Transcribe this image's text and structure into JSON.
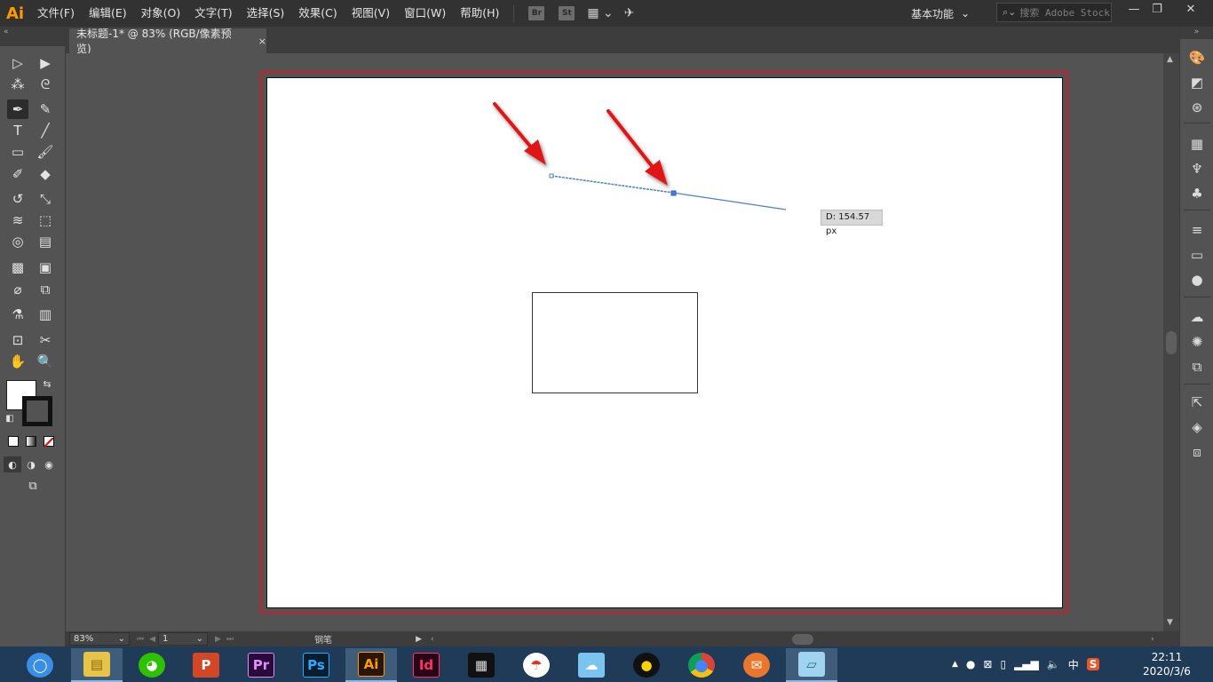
{
  "app": {
    "logo": "Ai",
    "menus": [
      "文件(F)",
      "编辑(E)",
      "对象(O)",
      "文字(T)",
      "选择(S)",
      "效果(C)",
      "视图(V)",
      "窗口(W)",
      "帮助(H)"
    ],
    "bridge_button": "Br",
    "stock_button": "St",
    "workspace": "基本功能",
    "search_placeholder": "搜索 Adobe Stock",
    "window_controls": {
      "minimize": "—",
      "restore": "❐",
      "close": "✕"
    }
  },
  "document": {
    "tab_title": "未标题-1* @ 83% (RGB/像素预览)",
    "tab_close": "×",
    "measure_tooltip": "D: 154.57 px"
  },
  "tools": {
    "names": [
      "selection-tool",
      "direct-selection-tool",
      "magic-wand-tool",
      "lasso-tool",
      "pen-tool",
      "curvature-tool",
      "type-tool",
      "line-segment-tool",
      "rectangle-tool",
      "paintbrush-tool",
      "shaper-tool",
      "eraser-tool",
      "rotate-tool",
      "scale-tool",
      "width-tool",
      "free-transform-tool",
      "shape-builder-tool",
      "perspective-grid-tool",
      "mesh-tool",
      "gradient-tool",
      "eyedropper-tool",
      "blend-tool",
      "symbol-sprayer-tool",
      "column-graph-tool",
      "artboard-tool",
      "slice-tool",
      "hand-tool",
      "zoom-tool"
    ],
    "active": "pen-tool",
    "fill_color": "#ffffff",
    "stroke_color": "#000000"
  },
  "status": {
    "zoom": "83%",
    "artboard_number": "1",
    "current_tool": "钢笔"
  },
  "right_panel": {
    "icons": [
      "color-icon",
      "color-guide-icon",
      "color-themes-icon",
      "swatches-icon",
      "brushes-icon",
      "symbols-icon",
      "stroke-icon",
      "gradient-icon",
      "transparency-icon",
      "cc-libraries-icon",
      "appearance-icon",
      "graphic-styles-icon",
      "export-icon",
      "layers-icon",
      "artboards-icon"
    ]
  },
  "taskbar": {
    "apps": [
      "browser",
      "file-explorer",
      "wechat",
      "powerpoint",
      "premiere",
      "photoshop",
      "illustrator",
      "indesign",
      "video-editor",
      "umbrella-app",
      "cat-app",
      "qq",
      "chrome",
      "foxmail",
      "notes-app"
    ],
    "active": "illustrator",
    "labels": {
      "powerpoint": "P",
      "premiere": "Pr",
      "photoshop": "Ps",
      "illustrator": "Ai",
      "indesign": "Id"
    },
    "tray": {
      "ime": "中",
      "sogou": "S"
    },
    "time": "22:11",
    "date": "2020/3/6"
  },
  "colors": {
    "ui_dark": "#323232",
    "panel": "#535353",
    "artboard_border": "#c8202a",
    "path_color": "#4a7fd4",
    "arrow_color": "#e01818",
    "taskbar": "#1f3b57"
  }
}
